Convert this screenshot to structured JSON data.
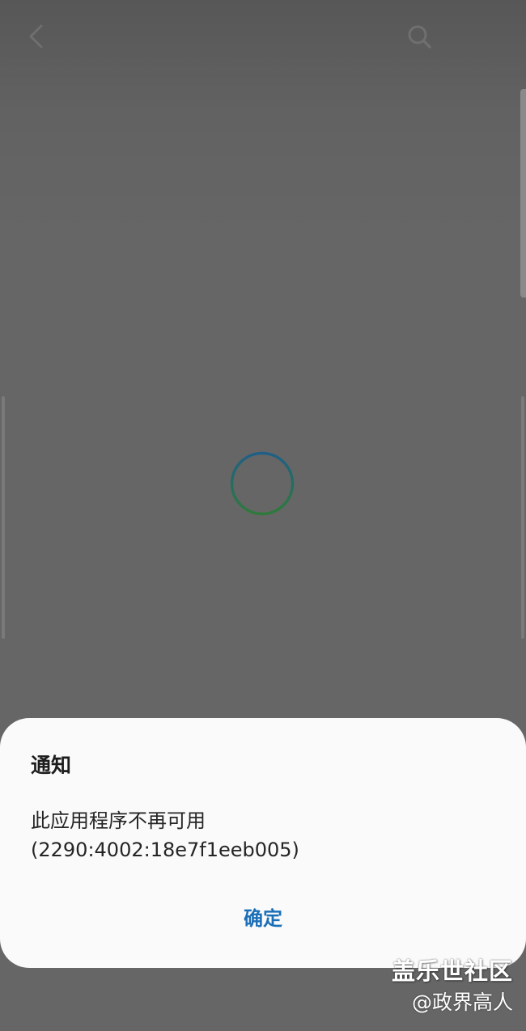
{
  "top_bar": {
    "back_icon": "chevron-left-icon",
    "search_icon": "search-icon"
  },
  "loading": {
    "icon": "loading-spinner-icon",
    "colors": [
      "#1f5f86",
      "#2f7a3b"
    ]
  },
  "dialog": {
    "title": "通知",
    "message_line1": "此应用程序不再可用",
    "message_line2": "(2290:4002:18e7f1eeb005)",
    "confirm_label": "确定",
    "accent_color": "#1b6fb8"
  },
  "watermark": {
    "brand": "盖乐世社区",
    "handle": "@政界高人"
  }
}
